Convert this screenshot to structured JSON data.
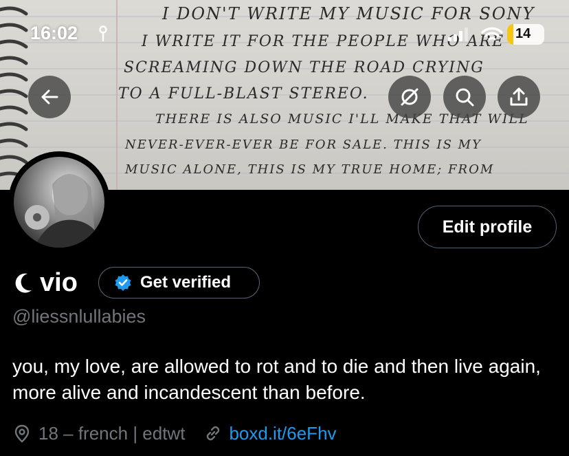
{
  "status_bar": {
    "time": "16:02",
    "battery_percent": "14"
  },
  "banner": {
    "handwriting_lines": [
      "I DON'T WRITE MY MUSIC FOR SONY",
      "I WRITE IT FOR THE PEOPLE WHO ARE",
      "SCREAMING DOWN THE ROAD CRYING",
      "TO A FULL-BLAST STEREO.",
      "THERE IS ALSO MUSIC I'LL MAKE THAT WILL",
      "NEVER-EVER-EVER BE FOR SALE. THIS IS MY",
      "MUSIC ALONE, THIS IS MY TRUE HOME; FROM"
    ]
  },
  "header_buttons": {
    "back": "arrow-left-icon",
    "hide": "eye-slash-icon",
    "search": "search-icon",
    "share": "share-icon"
  },
  "profile": {
    "name": "vio",
    "name_prefix_icon": "crescent-moon-icon",
    "edit_label": "Edit profile",
    "verify_label": "Get verified",
    "handle": "@liessnlullabies",
    "bio": "you, my love, are allowed to rot and to die and then live again, more alive and incandescent than before.",
    "location": "18 – french | edtwt",
    "link": "boxd.it/6eFhv"
  },
  "colors": {
    "accent": "#1d9bf0",
    "muted": "#71767b",
    "background": "#000000"
  }
}
